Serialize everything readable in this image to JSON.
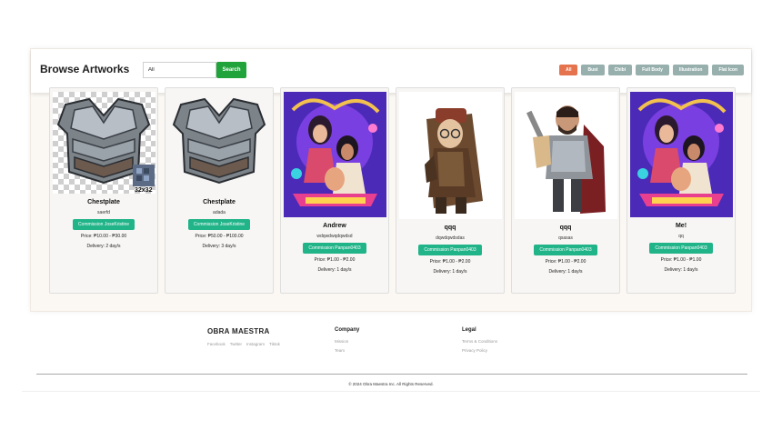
{
  "page": {
    "title": "Browse Artworks"
  },
  "search": {
    "value": "All",
    "button_label": "Search"
  },
  "filters": [
    {
      "label": "All",
      "active": true
    },
    {
      "label": "Bust",
      "active": false
    },
    {
      "label": "Chibi",
      "active": false
    },
    {
      "label": "Full Body",
      "active": false
    },
    {
      "label": "Illustration",
      "active": false
    },
    {
      "label": "Flat Icon",
      "active": false
    }
  ],
  "artworks": [
    {
      "name": "Chestplate",
      "description": "saerfd",
      "commission": "Commission JoseKristine",
      "price": "Price: ₱10.00 - ₱30.00",
      "delivery": "Delivery: 2 day/s",
      "image": "pixel-chestplate-icon",
      "image_caption": "32x32"
    },
    {
      "name": "Chestplate",
      "description": "adada",
      "commission": "Commission JoseKristine",
      "price": "Price: ₱50.00 - ₱100.00",
      "delivery": "Delivery: 3 day/s",
      "image": "pixel-chestplate-icon"
    },
    {
      "name": "Andrew",
      "description": "wdqwdwqdqwdsd",
      "commission": "Commission Panpan0403",
      "price": "Price: ₱1.00 - ₱2.00",
      "delivery": "Delivery: 1 day/s",
      "image": "illustration-poster-icon"
    },
    {
      "name": "qqq",
      "description": "dqwdqwdsdas",
      "commission": "Commission Panpan0403",
      "price": "Price: ₱1.00 - ₱2.00",
      "delivery": "Delivery: 1 day/s",
      "image": "adventurer-character-icon"
    },
    {
      "name": "qqq",
      "description": "qsasas",
      "commission": "Commission Panpan0403",
      "price": "Price: ₱1.00 - ₱2.00",
      "delivery": "Delivery: 1 day/s",
      "image": "warrior-character-icon"
    },
    {
      "name": "Me!",
      "description": "qq",
      "commission": "Commission Panpan0403",
      "price": "Price: ₱1.00 - ₱1.00",
      "delivery": "Delivery: 1 day/s",
      "image": "illustration-poster-icon"
    }
  ],
  "footer": {
    "brand": "OBRA MAESTRA",
    "social": [
      "Facebook",
      "Twitter",
      "Instagram",
      "Tiktok"
    ],
    "company": {
      "heading": "Company",
      "links": [
        "Mission",
        "Team"
      ]
    },
    "legal": {
      "heading": "Legal",
      "links": [
        "Terms & Conditions",
        "Privacy Policy"
      ]
    },
    "copyright": "© 2024 Obra Maestra Inc. All Rights Reserved."
  },
  "colors": {
    "search_button": "#1fa33a",
    "filter_active": "#e5734d",
    "filter_inactive": "#97b0ad",
    "commission": "#20b488"
  }
}
